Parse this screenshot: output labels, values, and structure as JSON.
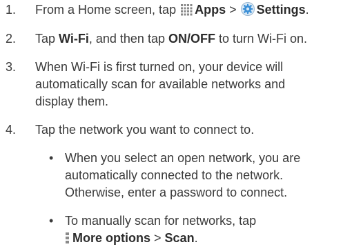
{
  "steps": [
    {
      "number": "1.",
      "prefix": "From a Home screen, tap",
      "apps": "Apps",
      "sep": ">",
      "settings": "Settings",
      "end": ".",
      "apps_icon": "apps-grid-icon",
      "settings_icon": "settings-gear-icon"
    },
    {
      "number": "2.",
      "prefix": "Tap",
      "wifi": "Wi-Fi",
      "middle": ", and then tap",
      "onoff": "ON/OFF",
      "end": "to turn Wi-Fi on."
    },
    {
      "number": "3.",
      "line1": "When Wi-Fi is first turned on, your device will",
      "line2": "automatically scan for available networks and",
      "line3": "display them."
    },
    {
      "number": "4.",
      "line1": "Tap the network you want to connect to."
    }
  ],
  "bullets": [
    {
      "symbol": "•",
      "line1": "When you select an open network, you are",
      "line2": "automatically connected to the network.",
      "line3": "Otherwise, enter a password to connect."
    },
    {
      "symbol": "•",
      "line1": "To manually scan for networks, tap",
      "more": "More options",
      "sep": ">",
      "scan": "Scan",
      "end": ".",
      "more_icon": "more-options-icon"
    }
  ],
  "colors": {
    "text": "#3a3a3a",
    "icon_gray": "#8a8a8a",
    "settings_blue": "#3b8fd6"
  }
}
